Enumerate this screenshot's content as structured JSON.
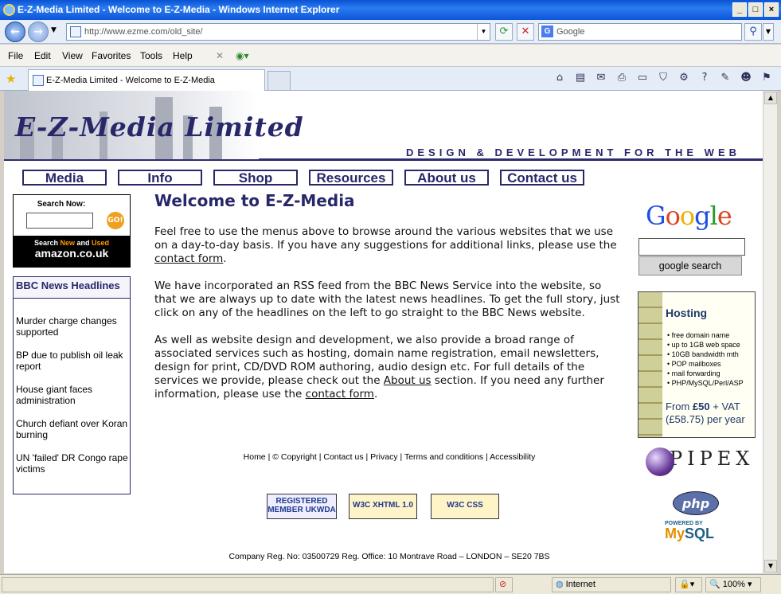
{
  "window": {
    "title": "E-Z-Media Limited - Welcome to E-Z-Media - Windows Internet Explorer"
  },
  "address": {
    "url": "http://www.ezme.com/old_site/"
  },
  "search": {
    "placeholder": "Google"
  },
  "menu": [
    "File",
    "Edit",
    "View",
    "Favorites",
    "Tools",
    "Help"
  ],
  "tab": {
    "title": "E-Z-Media Limited - Welcome to E-Z-Media"
  },
  "site": {
    "logo": "E-Z-Media Limited",
    "tagline": "DESIGN & DEVELOPMENT FOR THE WEB",
    "nav": [
      "Media",
      "Info",
      "Shop",
      "Resources",
      "About us",
      "Contact us"
    ]
  },
  "sidebar": {
    "search_label": "Search Now:",
    "go": "GO!",
    "amazon_line1a": "Search ",
    "amazon_new": "New",
    "amazon_and": " and ",
    "amazon_used": "Used",
    "amazon_logo": "amazon.co.uk",
    "news_title": "BBC News Headlines",
    "headlines": [
      "Murder charge changes supported",
      "BP due to publish oil leak report",
      "House giant faces administration",
      "Church defiant over Koran burning",
      "UN 'failed' DR Congo rape victims"
    ]
  },
  "main": {
    "heading": "Welcome to E-Z-Media",
    "p1_a": "Feel free to use the menus above to browse around the various websites that we use on a day-to-day basis. If you have any suggestions for additional links, please use the ",
    "p1_link": "contact form",
    "p1_b": ".",
    "p2": "We have incorporated an RSS feed from the BBC News Service into the website, so that we are always up to date with the latest news headlines. To get the full story, just click on any of the headlines on the left to go straight to the BBC News website.",
    "p3_a": "As well as website design and development, we also provide a broad range of associated services such as hosting, domain name registration, email newsletters, design for print, CD/DVD ROM authoring, audio design etc. For full details of the services we provide, please check out the ",
    "p3_link1": "About us",
    "p3_b": " section. If you need any further information, please use the ",
    "p3_link2": "contact form",
    "p3_c": "."
  },
  "footer": {
    "links": [
      "Home",
      "© Copyright",
      "Contact us",
      "Privacy",
      "Terms and conditions",
      "Accessibility"
    ],
    "badges": [
      "REGISTERED MEMBER UKWDA",
      "W3C XHTML 1.0",
      "W3C CSS"
    ],
    "company": "Company Reg. No: 03500729 Reg. Office: 10 Montrave Road – LONDON – SE20 7BS"
  },
  "right": {
    "google_logo": "Google",
    "google_button": "google search",
    "hosting_title": "Hosting",
    "hosting_items": [
      "free domain name",
      "up to 1GB web space",
      "10GB bandwidth mth",
      "POP mailboxes",
      "mail forwarding",
      "PHP/MySQL/Perl/ASP"
    ],
    "hosting_price_a": "From ",
    "hosting_price_b": "£50",
    "hosting_price_c": " + VAT",
    "hosting_price_d": "(£58.75) per year",
    "pipex": "PIPEX",
    "php": "php",
    "mysql_powered": "POWERED BY",
    "mysql_my": "My",
    "mysql_sql": "SQL"
  },
  "status": {
    "zone": "Internet",
    "zoom": "100%"
  }
}
